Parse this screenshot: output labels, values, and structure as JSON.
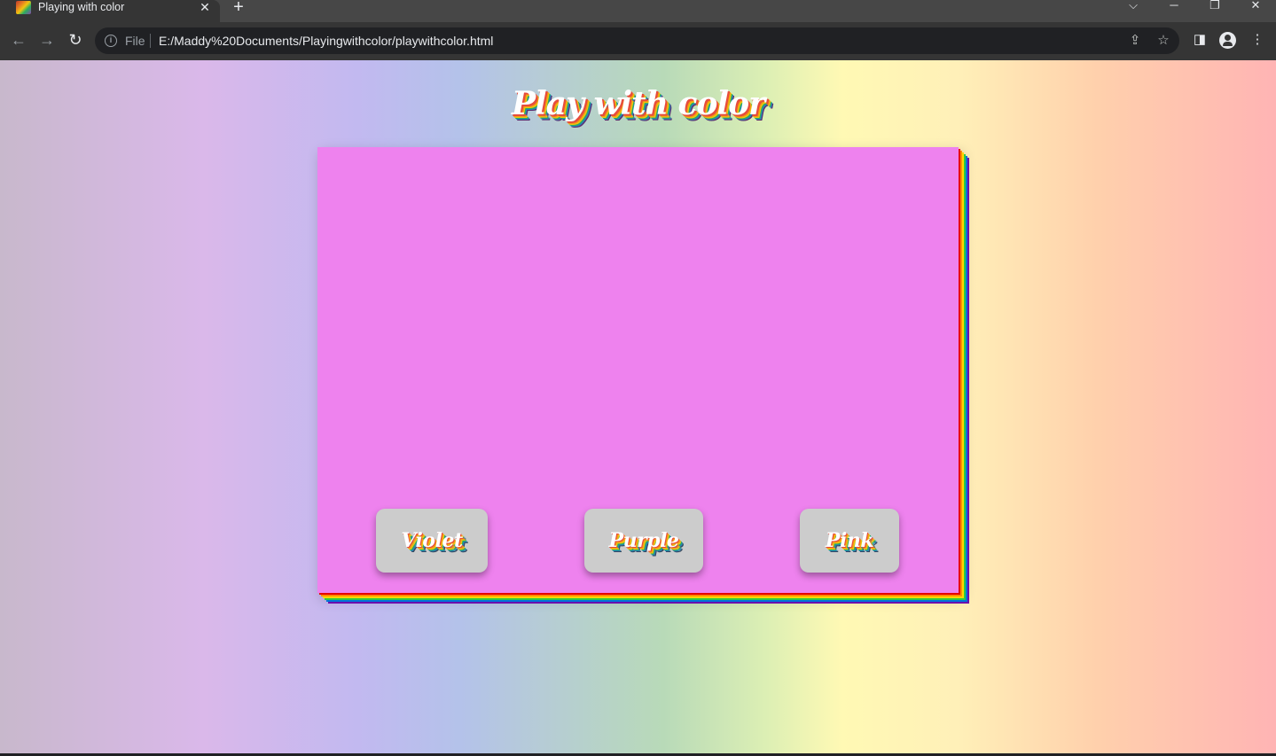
{
  "browser": {
    "tab": {
      "title": "Playing with color",
      "close_glyph": "✕"
    },
    "new_tab_glyph": "+",
    "address": {
      "scheme_label": "File",
      "url": "E:/Maddy%20Documents/Playingwithcolor/playwithcolor.html"
    },
    "icons": [
      "back-icon",
      "forward-icon",
      "reload-icon",
      "info-icon",
      "share-icon",
      "star-icon",
      "side-panel-icon",
      "profile-icon",
      "menu-icon",
      "tab-search-icon",
      "minimize-icon",
      "restore-icon",
      "close-icon"
    ]
  },
  "page": {
    "title": "Play with color",
    "box_color": "#ee82ee",
    "buttons": [
      {
        "label": "Violet"
      },
      {
        "label": "Purple"
      },
      {
        "label": "Pink"
      }
    ]
  }
}
